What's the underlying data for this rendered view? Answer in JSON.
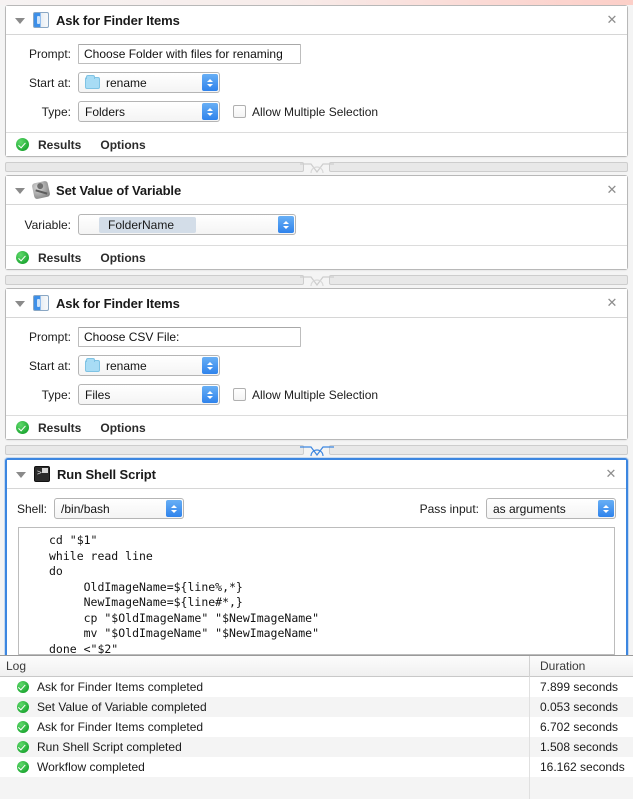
{
  "workflow": {
    "actions": [
      {
        "title": "Ask for Finder Items",
        "icon": "finder-icon",
        "close_label": "✕",
        "prompt_label": "Prompt:",
        "prompt_value": "Choose Folder with files for renaming",
        "start_at_label": "Start at:",
        "start_at_value": "rename",
        "type_label": "Type:",
        "type_value": "Folders",
        "allow_multiple_label": "Allow Multiple Selection",
        "results_label": "Results",
        "options_label": "Options"
      },
      {
        "title": "Set Value of Variable",
        "icon": "variable-icon",
        "close_label": "✕",
        "variable_label": "Variable:",
        "variable_value": "FolderName",
        "results_label": "Results",
        "options_label": "Options"
      },
      {
        "title": "Ask for Finder Items",
        "icon": "finder-icon",
        "close_label": "✕",
        "prompt_label": "Prompt:",
        "prompt_value": "Choose CSV File:",
        "start_at_label": "Start at:",
        "start_at_value": "rename",
        "type_label": "Type:",
        "type_value": "Files",
        "allow_multiple_label": "Allow Multiple Selection",
        "results_label": "Results",
        "options_label": "Options"
      },
      {
        "title": "Run Shell Script",
        "icon": "terminal-icon",
        "close_label": "✕",
        "shell_label": "Shell:",
        "shell_value": "/bin/bash",
        "pass_input_label": "Pass input:",
        "pass_input_value": "as arguments",
        "script": "cd \"$1\"\nwhile read line\ndo\n     OldImageName=${line%,*}\n     NewImageName=${line#*,}\n     cp \"$OldImageName\" \"$NewImageName\"\n     mv \"$OldImageName\" \"$NewImageName\"\ndone <\"$2\""
      }
    ]
  },
  "log": {
    "column_name": "Log",
    "column_duration": "Duration",
    "rows": [
      {
        "name": "Ask for Finder Items completed",
        "duration": "7.899 seconds"
      },
      {
        "name": "Set Value of Variable completed",
        "duration": "0.053 seconds"
      },
      {
        "name": "Ask for Finder Items completed",
        "duration": "6.702 seconds"
      },
      {
        "name": "Run Shell Script completed",
        "duration": "1.508 seconds"
      },
      {
        "name": "Workflow completed",
        "duration": "16.162 seconds"
      }
    ]
  },
  "colors": {
    "selection_blue": "#3c86e0",
    "success_green": "#21ab36",
    "popup_arrow_blue": "#2f83ec",
    "variable_token": "#d3dde8"
  }
}
